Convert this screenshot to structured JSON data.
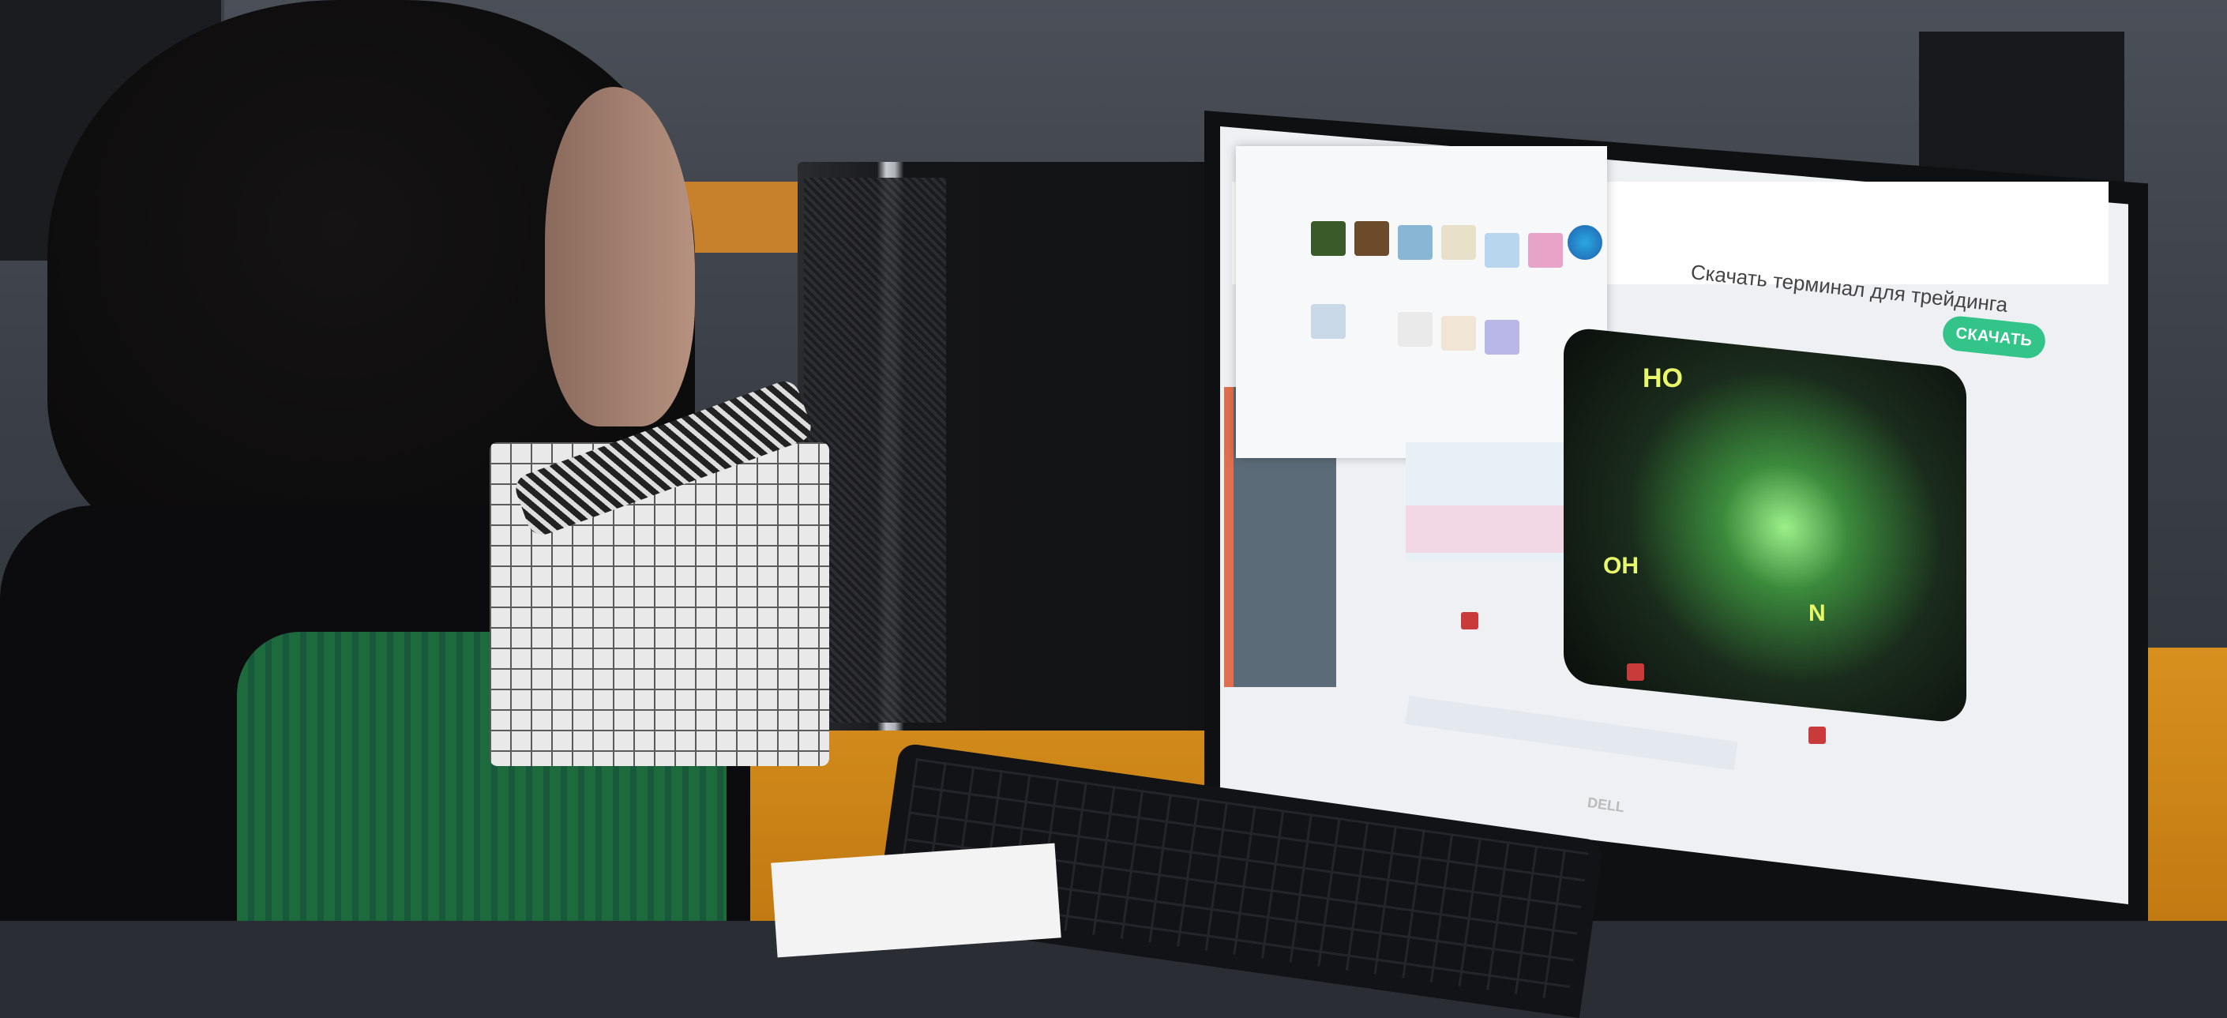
{
  "screen": {
    "page_title": "Скачать терминал для трейдинга",
    "download_button_label": "СКАЧАТЬ",
    "chem_labels": [
      "HO",
      "OH",
      "N"
    ]
  },
  "monitor": {
    "brand": "DELL"
  },
  "colors": {
    "download_button": "#33c48a",
    "sweater": "#1d6a3d",
    "desk": "#d7901e",
    "chem_glow": "#9cf08a"
  },
  "icons": [
    "download-icon",
    "browser-edge-icon"
  ]
}
